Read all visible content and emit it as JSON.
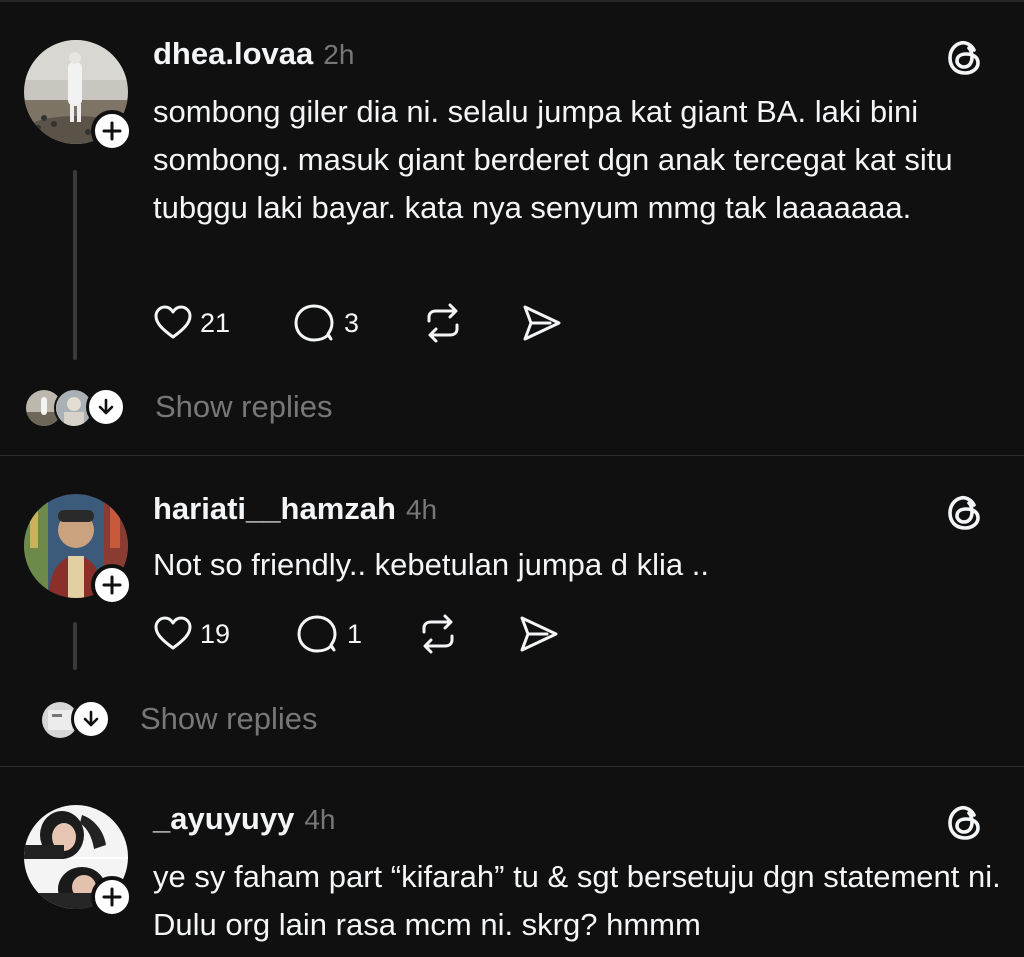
{
  "posts": [
    {
      "username": "dhea.lovaa",
      "time": "2h",
      "text": "sombong giler dia ni. selalu jumpa kat giant BA. laki bini sombong. masuk giant berderet dgn anak tercegat kat situ tubggu laki bayar. kata nya senyum mmg tak laaaaaaa.",
      "likes": "21",
      "replies": "3",
      "show_replies": "Show replies"
    },
    {
      "username": "hariati__hamzah",
      "time": "4h",
      "text": "Not so friendly.. kebetulan jumpa d klia ..",
      "likes": "19",
      "replies": "1",
      "show_replies": "Show replies"
    },
    {
      "username": "_ayuyuyy",
      "time": "4h",
      "text": "ye sy faham part “kifarah” tu & sgt bersetuju dgn statement ni. Dulu org lain rasa mcm ni. skrg? hmmm"
    }
  ],
  "icons": {
    "like": "heart-icon",
    "reply": "comment-bubble-icon",
    "repost": "repost-icon",
    "share": "send-icon",
    "app": "threads-logo-icon",
    "follow": "plus-icon",
    "expand": "arrow-down-icon"
  },
  "colors": {
    "background": "#101010",
    "text": "#f3f5f7",
    "muted": "#777777",
    "divider": "#2d2d2d"
  }
}
